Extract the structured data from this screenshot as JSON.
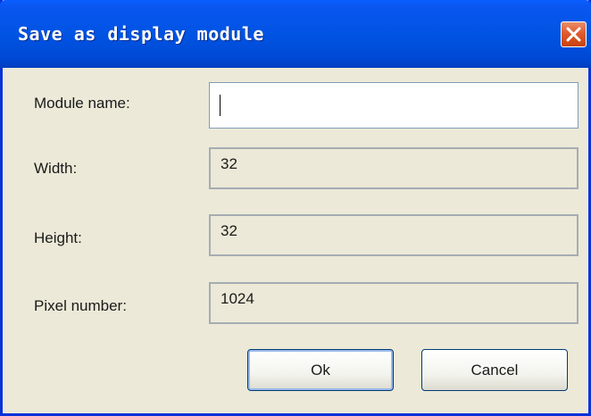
{
  "dialog": {
    "title": "Save as display module"
  },
  "fields": {
    "module_name_label": "Module name:",
    "module_name_value": "",
    "width_label": "Width:",
    "width_value": "32",
    "height_label": "Height:",
    "height_value": "32",
    "pixel_number_label": "Pixel number:",
    "pixel_number_value": "1024"
  },
  "buttons": {
    "ok_label": "Ok",
    "cancel_label": "Cancel"
  },
  "icons": {
    "close": "close-icon"
  },
  "colors": {
    "titlebar": "#0054e3",
    "close_button": "#e15b2f",
    "dialog_background": "#ece9d8"
  }
}
